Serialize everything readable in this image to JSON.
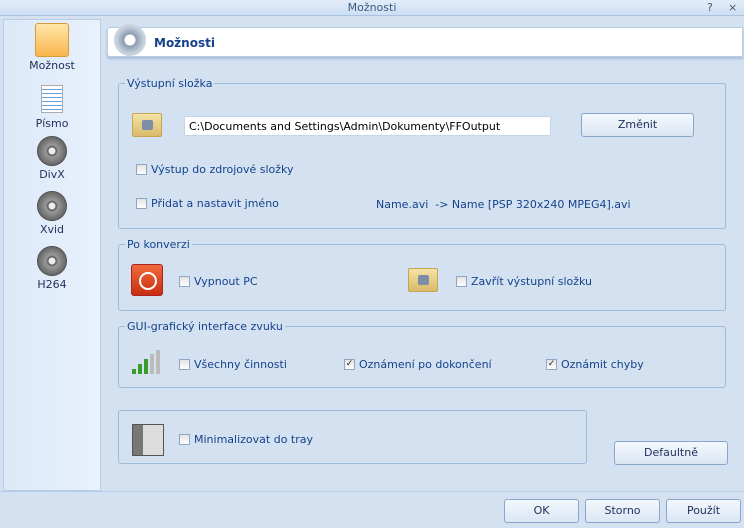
{
  "window": {
    "title": "Možnosti",
    "help": "?",
    "close": "×"
  },
  "sidebar": {
    "items": [
      {
        "label": "Možnost",
        "icon": "options-icon"
      },
      {
        "label": "Písmo",
        "icon": "document-icon"
      },
      {
        "label": "DivX",
        "icon": "film-reel-icon"
      },
      {
        "label": "Xvid",
        "icon": "film-reel-icon"
      },
      {
        "label": "H264",
        "icon": "film-reel-icon"
      }
    ]
  },
  "header": {
    "title": "Možnosti"
  },
  "output": {
    "legend": "Výstupní složka",
    "path": "C:\\Documents and Settings\\Admin\\Dokumenty\\FFOutput",
    "change": "Změnit",
    "source_folder": "Výstup do zdrojové složky",
    "add_name": "Přidat a nastavit jméno",
    "example": "Name.avi  -> Name [PSP 320x240 MPEG4].avi"
  },
  "after": {
    "legend": "Po konverzi",
    "shutdown": "Vypnout PC",
    "close_folder": "Zavřít výstupní složku"
  },
  "sound": {
    "legend": "GUI-grafický interface zvuku",
    "all": "Všechny činnosti",
    "on_done": "Oznámení po dokončení",
    "errors": "Oznámit chyby"
  },
  "tray": {
    "minimize": "Minimalizovat do tray"
  },
  "buttons": {
    "default": "Defaultně",
    "ok": "OK",
    "cancel": "Storno",
    "apply": "Použít"
  }
}
